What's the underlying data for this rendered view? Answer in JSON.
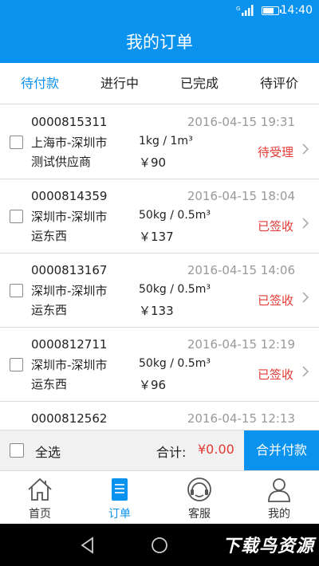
{
  "status_bar": {
    "time": "14:40",
    "signal_label": "G",
    "battery_level": 0.7
  },
  "header": {
    "title": "我的订单"
  },
  "tabs": [
    {
      "label": "待付款",
      "active": true
    },
    {
      "label": "进行中",
      "active": false
    },
    {
      "label": "已完成",
      "active": false
    },
    {
      "label": "待评价",
      "active": false
    }
  ],
  "orders": [
    {
      "order_no": "0000815311",
      "date": "2016-04-15 19:31",
      "route": "上海市-深圳市",
      "company": "测试供应商",
      "weight": "1kg / 1m³",
      "price": "￥90",
      "status": "待受理"
    },
    {
      "order_no": "0000814359",
      "date": "2016-04-15 18:04",
      "route": "深圳市-深圳市",
      "company": "运东西",
      "weight": "50kg / 0.5m³",
      "price": "￥137",
      "status": "已签收"
    },
    {
      "order_no": "0000813167",
      "date": "2016-04-15 14:06",
      "route": "深圳市-深圳市",
      "company": "运东西",
      "weight": "50kg / 0.5m³",
      "price": "￥133",
      "status": "已签收"
    },
    {
      "order_no": "0000812711",
      "date": "2016-04-15 12:19",
      "route": "深圳市-深圳市",
      "company": "运东西",
      "weight": "50kg / 0.5m³",
      "price": "￥96",
      "status": "已签收"
    },
    {
      "order_no": "0000812562",
      "date": "2016-04-15 12:13",
      "route": "",
      "company": "",
      "weight": "",
      "price": "",
      "status": ""
    }
  ],
  "footer": {
    "select_all": "全选",
    "total_label": "合计:",
    "total_value": "¥0.00",
    "pay_button": "合并付款"
  },
  "nav": [
    {
      "label": "首页",
      "icon": "home-icon",
      "active": false
    },
    {
      "label": "订单",
      "icon": "order-icon",
      "active": true
    },
    {
      "label": "客服",
      "icon": "headset-icon",
      "active": false
    },
    {
      "label": "我的",
      "icon": "person-icon",
      "active": false
    }
  ],
  "watermark": "下载鸟资源",
  "colors": {
    "primary": "#0a93ee",
    "status_red": "#e53935"
  }
}
